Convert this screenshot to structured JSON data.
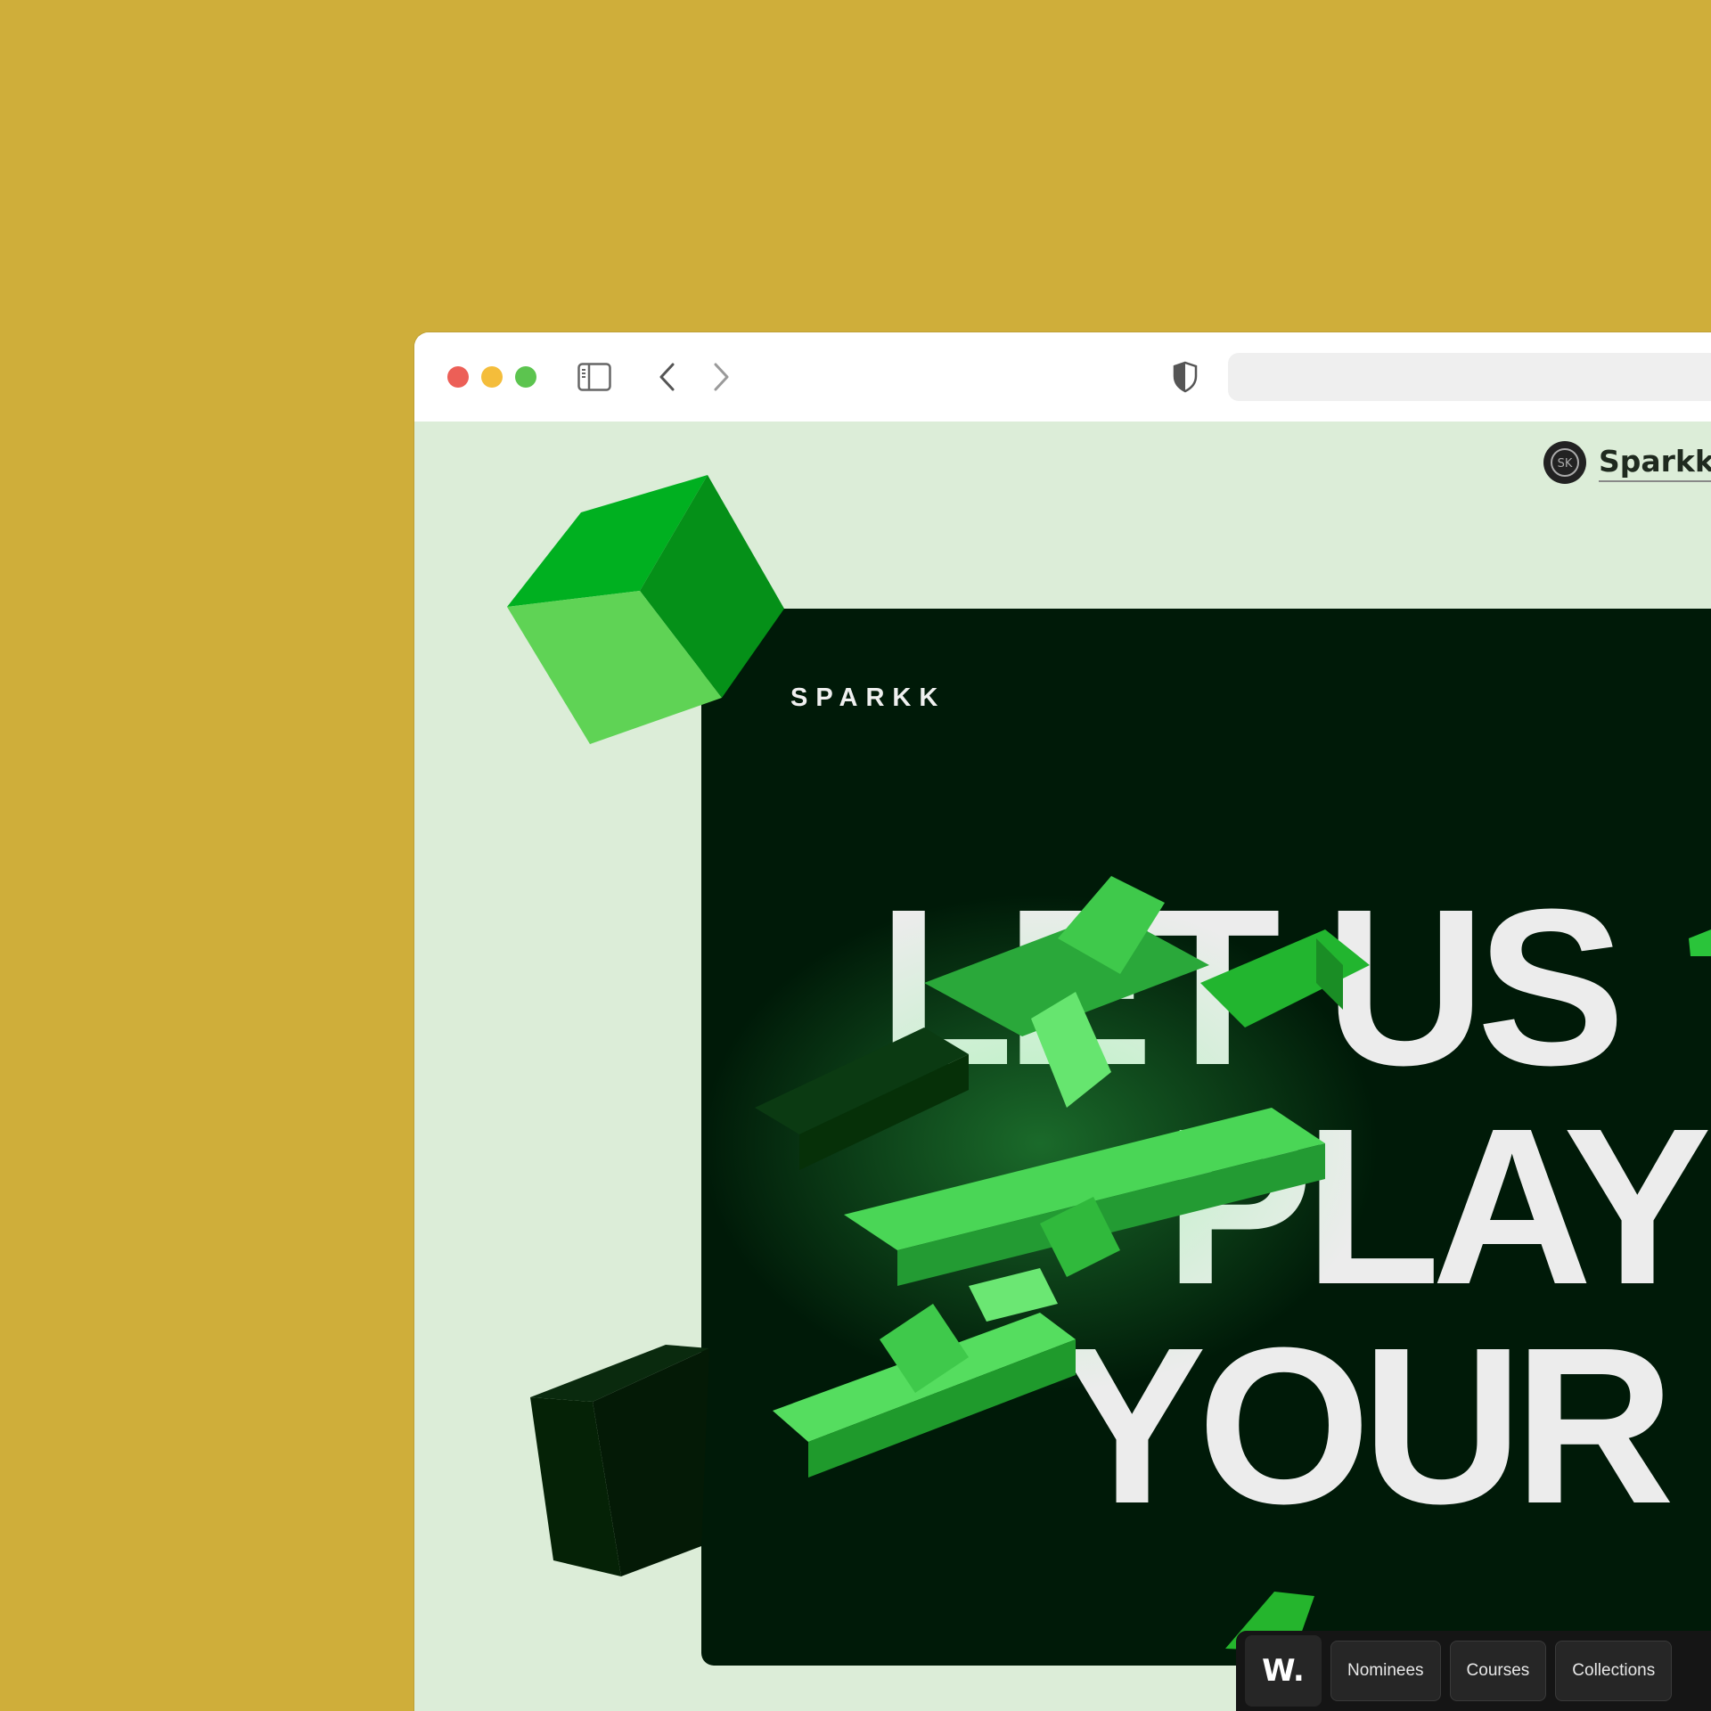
{
  "browser": {
    "icons": {
      "sidebar": "sidebar-icon",
      "back": "chevron-left-icon",
      "forward": "chevron-right-icon",
      "privacy": "shield-icon"
    },
    "url": ""
  },
  "site_badge": {
    "name": "Sparkk",
    "avatar_icon": "sparkk-avatar-icon"
  },
  "hero": {
    "logo": "SPARKK",
    "headline": [
      "LET US",
      "PLAY",
      "YOUR"
    ]
  },
  "bottom_bar": {
    "logo": "W.",
    "items": [
      "Nominees",
      "Courses",
      "Collections"
    ]
  },
  "colors": {
    "page_background": "#cfae3a",
    "site_background": "#dcedd8",
    "hero_background": "#001a08",
    "accent_green": "#22c02b",
    "headline_text": "#ececec"
  }
}
